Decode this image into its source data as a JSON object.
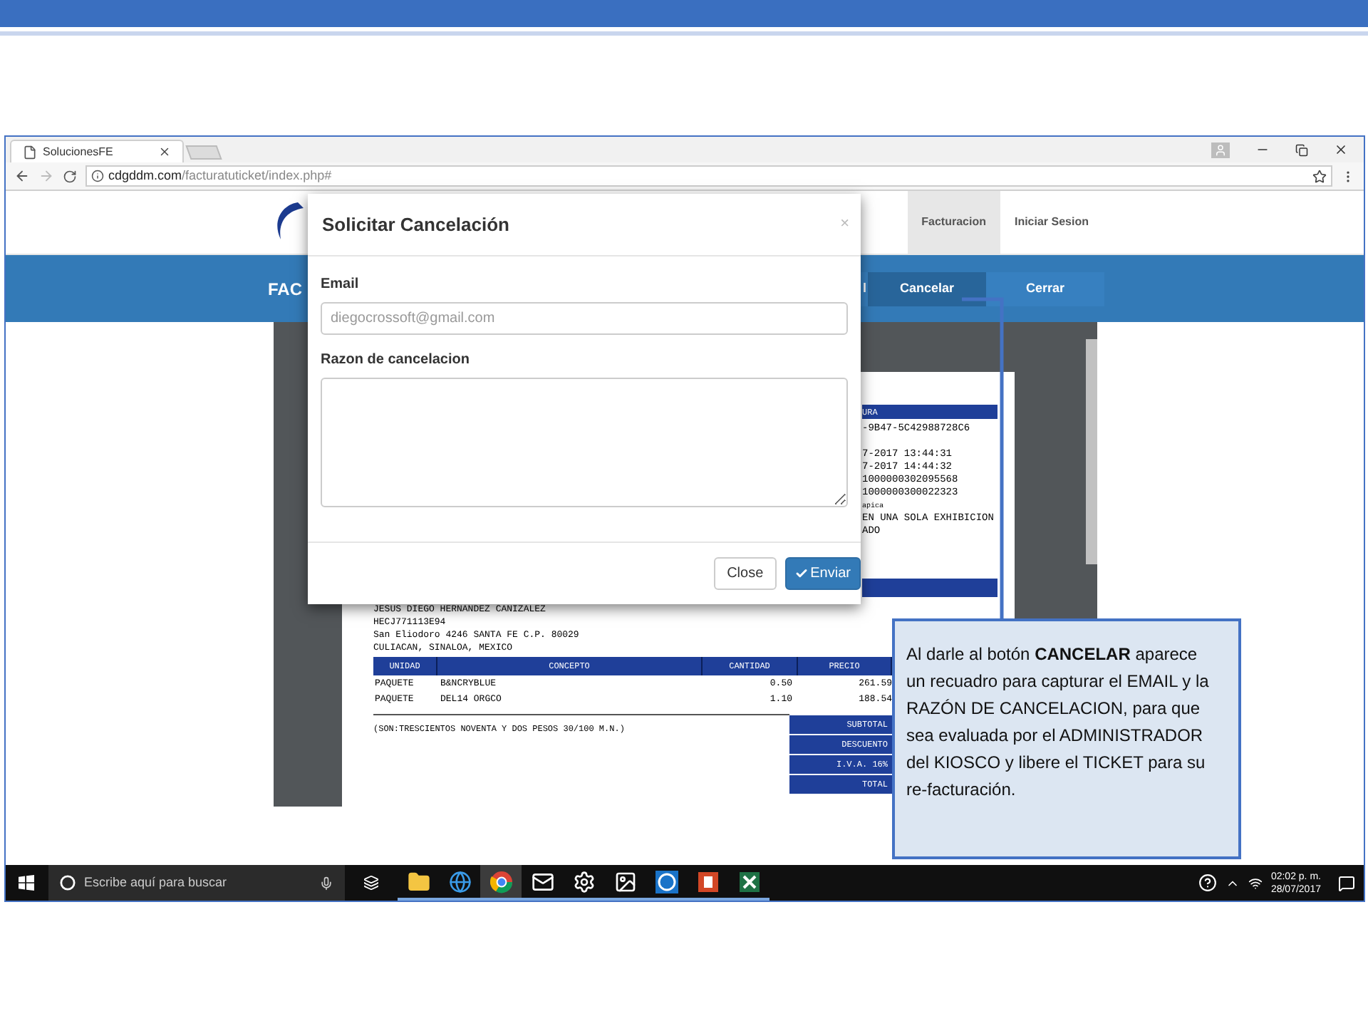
{
  "browser": {
    "tab": {
      "title": "SolucionesFE"
    },
    "url": {
      "host": "cdgddm.com",
      "path": "/facturatuticket/index.php#"
    }
  },
  "site": {
    "nav": [
      {
        "label": "Facturacion",
        "selected": true
      },
      {
        "label": "Iniciar Sesion",
        "selected": false
      }
    ],
    "banner_title": "FAC",
    "banner_buttons": [
      {
        "label": "l",
        "selected": false
      },
      {
        "label": "Cancelar",
        "selected": true
      },
      {
        "label": "Cerrar",
        "selected": false
      }
    ]
  },
  "invoice": {
    "header_fragment": "URA",
    "upper_fragments": [
      "-9B47-5C42988728C6",
      "7-2017 13:44:31",
      "7-2017 14:44:32",
      "1000000302095568",
      "1000000300022323",
      "apica",
      "EN UNA SOLA EXHIBICION",
      "ADO"
    ],
    "customer_lines": [
      "JESUS DIEGO HERNANDEZ CANIZALEZ",
      "HECJ771113E94",
      "San Eliodoro 4246 SANTA FE C.P. 80029",
      "CULIACAN, SINALOA, MEXICO"
    ],
    "columns": [
      "UNIDAD",
      "CONCEPTO",
      "CANTIDAD",
      "PRECIO"
    ],
    "rows": [
      [
        "PAQUETE",
        "B&NCRYBLUE",
        "0.50",
        "261.59"
      ],
      [
        "PAQUETE",
        "DEL14 ORGCO",
        "1.10",
        "188.54"
      ]
    ],
    "amount_in_words": "(SON:TRESCIENTOS NOVENTA Y DOS PESOS 30/100 M.N.)",
    "totals": [
      "SUBTOTAL",
      "DESCUENTO",
      "I.V.A. 16%",
      "TOTAL"
    ]
  },
  "modal": {
    "title": "Solicitar Cancelación",
    "close_symbol": "×",
    "fields": [
      {
        "label": "Email",
        "kind": "input",
        "placeholder": "diegocrossoft@gmail.com"
      },
      {
        "label": "Razon de cancelacion",
        "kind": "textarea"
      }
    ],
    "buttons": [
      {
        "label": "Close",
        "kind": "default"
      },
      {
        "label": "Enviar",
        "kind": "primary"
      }
    ]
  },
  "taskbar": {
    "search_placeholder": "Escribe aquí para buscar",
    "time": "02:02 p. m.",
    "date": "28/07/2017",
    "apps": [
      {
        "selected": false
      },
      {
        "selected": false
      },
      {
        "selected": true
      },
      {
        "selected": false
      },
      {
        "selected": false
      },
      {
        "selected": false
      },
      {
        "selected": false
      },
      {
        "selected": false
      },
      {
        "selected": false
      }
    ]
  },
  "callout": {
    "text": "Al darle al botón **CANCELAR** aparece un recuadro para capturar el EMAIL y la RAZÓN DE CANCELACION, para que sea evaluada por el ADMINISTRADOR del KIOSCO y libere el TICKET para su re-facturación."
  }
}
